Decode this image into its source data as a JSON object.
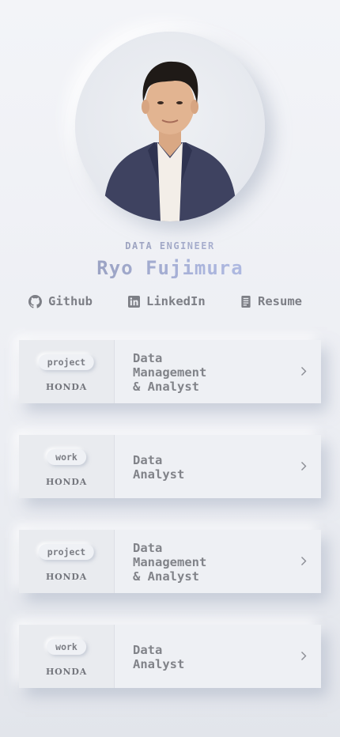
{
  "profile": {
    "role": "DATA ENGINEER",
    "name": "Ryo Fujimura",
    "photo_icon": "profile-photo"
  },
  "links": [
    {
      "label": "Github",
      "icon": "github-icon"
    },
    {
      "label": "LinkedIn",
      "icon": "linkedin-icon"
    },
    {
      "label": "Resume",
      "icon": "document-icon"
    }
  ],
  "cards": [
    {
      "tag": "project",
      "company": "HONDA",
      "title": "Data\nManagement\n& Analyst"
    },
    {
      "tag": "work",
      "company": "HONDA",
      "title": "Data\nAnalyst"
    },
    {
      "tag": "project",
      "company": "HONDA",
      "title": "Data\nManagement\n& Analyst"
    },
    {
      "tag": "work",
      "company": "HONDA",
      "title": "Data\nAnalyst"
    }
  ]
}
